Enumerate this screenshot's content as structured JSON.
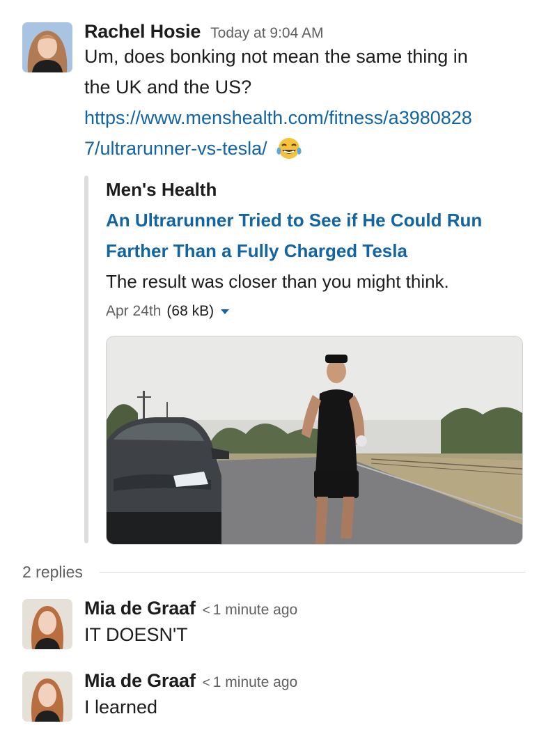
{
  "message": {
    "author": "Rachel Hosie",
    "timestamp": "Today at 9:04 AM",
    "text_line1": "Um, does bonking not mean the same thing in",
    "text_line2": "the UK and the US?",
    "link_line1": "https://www.menshealth.com/fitness/a3980828",
    "link_line2": "7/ultrarunner-vs-tesla/",
    "emoji": "joy-emoji"
  },
  "unfurl": {
    "site": "Men's Health",
    "title_line1": "An Ultrarunner Tried to See if He Could Run",
    "title_line2": "Farther Than a Fully Charged Tesla",
    "description": "The result was closer than you might think.",
    "date": "Apr 24th",
    "size": "(68 kB)"
  },
  "thread": {
    "replies_label": "2 replies",
    "replies": [
      {
        "author": "Mia de Graaf",
        "chevron": "<",
        "timestamp": "1 minute ago",
        "text": "IT DOESN'T"
      },
      {
        "author": "Mia de Graaf",
        "chevron": "<",
        "timestamp": "1 minute ago",
        "text": "I learned"
      }
    ]
  },
  "colors": {
    "link": "#1264a3",
    "muted": "#616061",
    "text": "#1d1c1d",
    "attachment_bar": "#dddddd"
  }
}
